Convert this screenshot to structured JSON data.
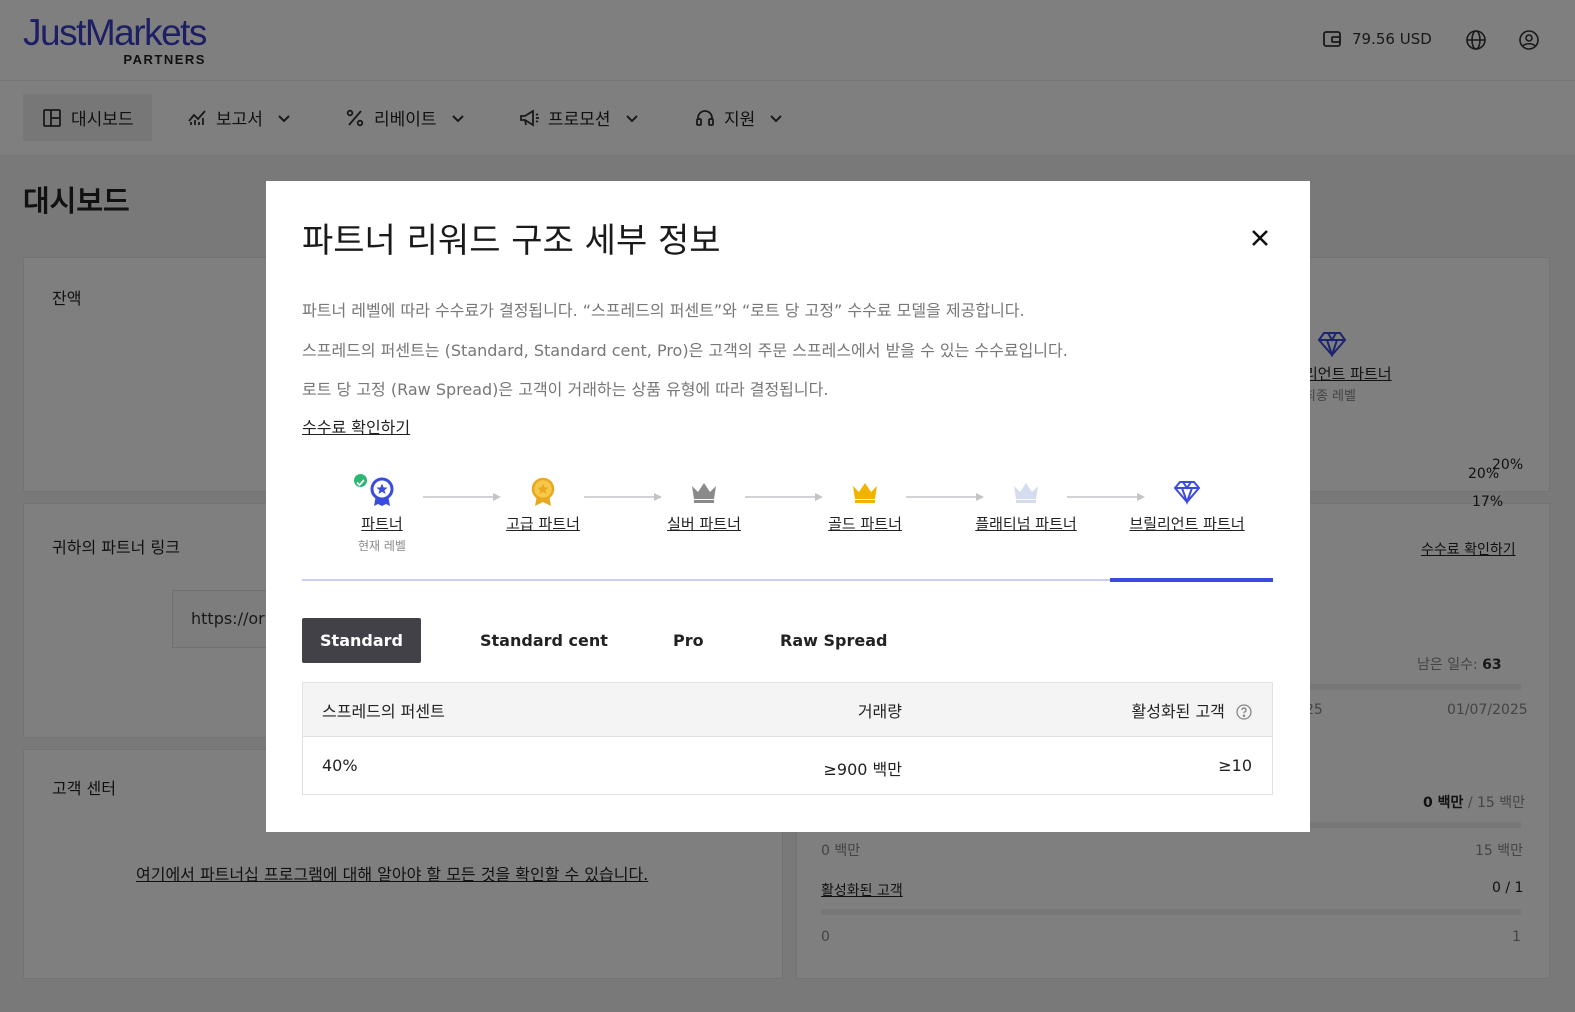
{
  "header": {
    "logo_main": "JustMarkets",
    "logo_sub": "PARTNERS",
    "balance": "79.56 USD"
  },
  "nav": {
    "items": [
      {
        "label": "대시보드"
      },
      {
        "label": "보고서"
      },
      {
        "label": "리베이트"
      },
      {
        "label": "프로모션"
      },
      {
        "label": "지원"
      }
    ]
  },
  "page": {
    "title": "대시보드",
    "balance_label": "잔액",
    "partner_link_label": "귀하의 파트너 링크",
    "partner_link_value": "https://or",
    "client_center_label": "고객 센터",
    "client_center_link": "여기에서 파트너십 프로그램에 대해 알아야 할 모든 것을 확인할 수 있습니다.",
    "right_level_name": "리언트 파트너",
    "right_level_sub": "최종 레벨",
    "right_rates": [
      "20%",
      "20%",
      "17%"
    ],
    "right_fee_link": "수수료 확인하기",
    "days_left_label": "남은 일수:",
    "days_left_value": "63",
    "date_start_partial": "25",
    "date_end": "01/07/2025",
    "volume_value": "0 백만",
    "volume_total": "/ 15 백만",
    "volume_min": "0 백만",
    "volume_max": "15 백만",
    "active_clients_label": "활성화된 고객",
    "active_clients_value": "0 / 1",
    "active_min": "0",
    "active_max": "1"
  },
  "modal": {
    "title": "파트너 리워드 구조 세부 정보",
    "desc1": "파트너 레벨에 따라 수수료가 결정됩니다. “스프레드의 퍼센트”와 “로트 당 고정” 수수료 모델을 제공합니다.",
    "desc2": "스프레드의 퍼센트는 (Standard, Standard cent, Pro)은 고객의 주문 스프레스에서 받을 수 있는 수수료입니다.",
    "desc3": "로트 당 고정 (Raw Spread)은 고객이 거래하는 상품 유형에 따라 결정됩니다.",
    "fee_link": "수수료 확인하기",
    "levels": [
      {
        "name": "파트너",
        "sub": "현재 레벨",
        "icon": "badge-star-icon",
        "color": "#3a4be0"
      },
      {
        "name": "고급 파트너",
        "sub": "",
        "icon": "medal-icon",
        "color": "#e8a820"
      },
      {
        "name": "실버 파트너",
        "sub": "",
        "icon": "crown-icon",
        "color": "#8a8a8a"
      },
      {
        "name": "골드 파트너",
        "sub": "",
        "icon": "crown-icon",
        "color": "#f0b400"
      },
      {
        "name": "플래티넘 파트너",
        "sub": "",
        "icon": "crown-icon",
        "color": "#cdd5ee"
      },
      {
        "name": "브릴리언트 파트너",
        "sub": "",
        "icon": "diamond-icon",
        "color": "#3a4be0"
      }
    ],
    "tabs": [
      "Standard",
      "Standard cent",
      "Pro",
      "Raw Spread"
    ],
    "table": {
      "headers": [
        "스프레드의 퍼센트",
        "거래량",
        "활성화된 고객"
      ],
      "row": [
        "40%",
        "≥900 백만",
        "≥10"
      ]
    }
  }
}
